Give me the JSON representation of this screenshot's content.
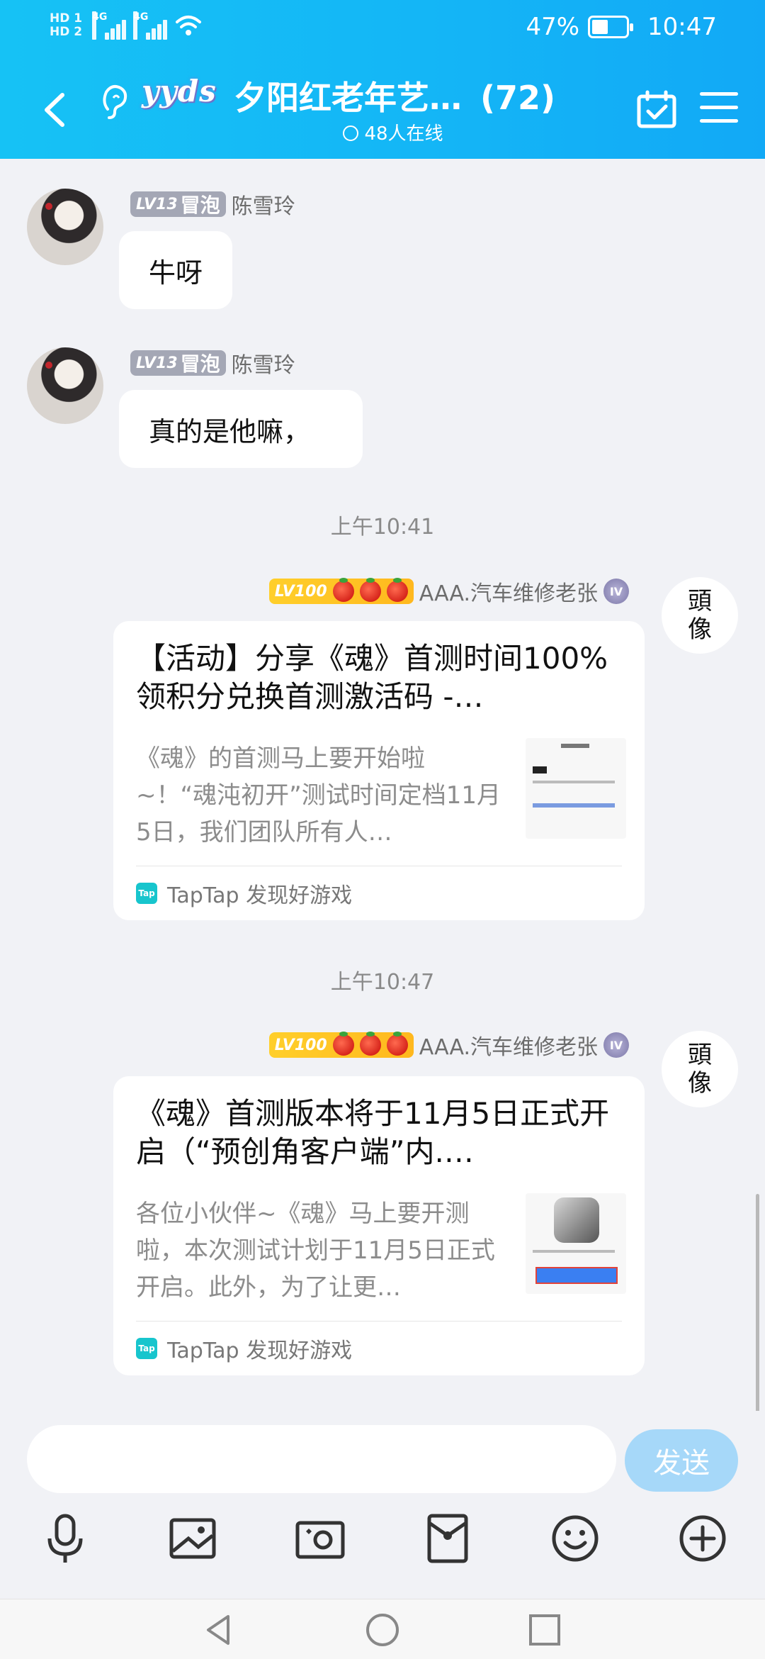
{
  "status_bar": {
    "hd1": "HD 1",
    "hd2": "HD 2",
    "net1": "4G",
    "net2": "4G",
    "battery": "47%",
    "time": "10:47"
  },
  "header": {
    "badge": "yyds",
    "title": "夕阳红老年艺…",
    "member_count": "(72)",
    "online": "48人在线"
  },
  "messages": [
    {
      "badge_level": "LV13",
      "badge_text": "冒泡",
      "sender": "陈雪玲",
      "text": "牛呀"
    },
    {
      "badge_level": "LV13",
      "badge_text": "冒泡",
      "sender": "陈雪玲",
      "text": "真的是他嘛，"
    }
  ],
  "timestamps": [
    "上午10:41",
    "上午10:47"
  ],
  "cards": [
    {
      "badge_level": "LV100",
      "sender": "AAA.汽车维修老张",
      "rank": "IV",
      "title": "【活动】分享《魂》首测时间100%领积分兑换首测激活码 -…",
      "desc": "《魂》的首测马上要开始啦~！“魂沌初开”测试时间定档11月5日，我们团队所有人…",
      "source": "TapTap 发现好游戏",
      "source_logo": "Tap"
    },
    {
      "badge_level": "LV100",
      "sender": "AAA.汽车维修老张",
      "rank": "IV",
      "title": "《魂》首测版本将于11月5日正式开启（“预创角客户端”内.…",
      "desc": "各位小伙伴~《魂》马上要开测啦，本次测试计划于11月5日正式开启。此外，为了让更…",
      "source": "TapTap 发现好游戏",
      "source_logo": "Tap"
    }
  ],
  "avatar_calligraphy": [
    "頭",
    "像"
  ],
  "input": {
    "placeholder": "",
    "send_label": "发送"
  },
  "toolbar_icons": [
    "microphone-icon",
    "image-icon",
    "camera-icon",
    "red-packet-icon",
    "emoji-icon",
    "plus-icon"
  ],
  "colors": {
    "header": "#16c2f5",
    "send_button": "#a6d8f9",
    "chat_bg": "#f1f2f6"
  }
}
